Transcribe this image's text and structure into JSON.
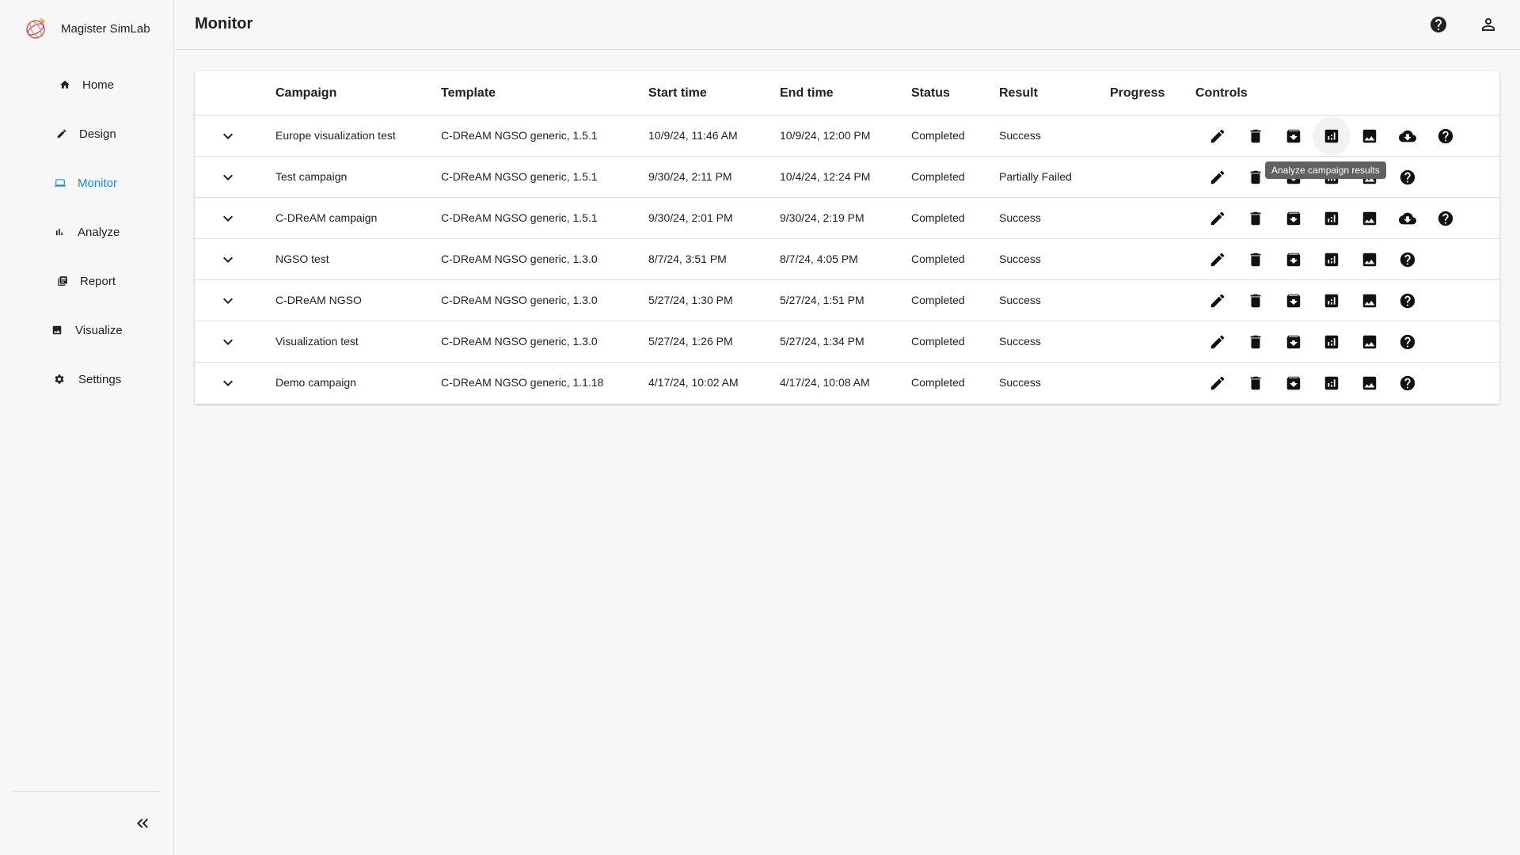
{
  "app": {
    "name": "Magister SimLab"
  },
  "nav": {
    "items": [
      {
        "label": "Home",
        "icon": "home-icon"
      },
      {
        "label": "Design",
        "icon": "pencil-icon"
      },
      {
        "label": "Monitor",
        "icon": "laptop-icon",
        "active": true
      },
      {
        "label": "Analyze",
        "icon": "bar-chart-icon"
      },
      {
        "label": "Report",
        "icon": "library-books-icon"
      },
      {
        "label": "Visualize",
        "icon": "image-icon"
      },
      {
        "label": "Settings",
        "icon": "gear-icon"
      }
    ]
  },
  "header": {
    "title": "Monitor"
  },
  "table": {
    "columns": [
      "Campaign",
      "Template",
      "Start time",
      "End time",
      "Status",
      "Result",
      "Progress",
      "Controls"
    ],
    "rows": [
      {
        "campaign": "Europe visualization test",
        "template": "C-DReAM NGSO generic, 1.5.1",
        "start": "10/9/24, 11:46 AM",
        "end": "10/9/24, 12:00 PM",
        "status": "Completed",
        "result": "Success",
        "download": true
      },
      {
        "campaign": "Test campaign",
        "template": "C-DReAM NGSO generic, 1.5.1",
        "start": "9/30/24, 2:11 PM",
        "end": "10/4/24, 12:24 PM",
        "status": "Completed",
        "result": "Partially Failed",
        "download": false
      },
      {
        "campaign": "C-DReAM campaign",
        "template": "C-DReAM NGSO generic, 1.5.1",
        "start": "9/30/24, 2:01 PM",
        "end": "9/30/24, 2:19 PM",
        "status": "Completed",
        "result": "Success",
        "download": true
      },
      {
        "campaign": "NGSO test",
        "template": "C-DReAM NGSO generic, 1.3.0",
        "start": "8/7/24, 3:51 PM",
        "end": "8/7/24, 4:05 PM",
        "status": "Completed",
        "result": "Success",
        "download": false
      },
      {
        "campaign": "C-DReAM NGSO",
        "template": "C-DReAM NGSO generic, 1.3.0",
        "start": "5/27/24, 1:30 PM",
        "end": "5/27/24, 1:51 PM",
        "status": "Completed",
        "result": "Success",
        "download": false
      },
      {
        "campaign": "Visualization test",
        "template": "C-DReAM NGSO generic, 1.3.0",
        "start": "5/27/24, 1:26 PM",
        "end": "5/27/24, 1:34 PM",
        "status": "Completed",
        "result": "Success",
        "download": false
      },
      {
        "campaign": "Demo campaign",
        "template": "C-DReAM NGSO generic, 1.1.18",
        "start": "4/17/24, 10:02 AM",
        "end": "4/17/24, 10:08 AM",
        "status": "Completed",
        "result": "Success",
        "download": false
      }
    ]
  },
  "tooltip": {
    "text": "Analyze campaign results"
  },
  "colors": {
    "accent": "#1e88c8",
    "background": "#f7f7f7",
    "card": "#ffffff"
  }
}
